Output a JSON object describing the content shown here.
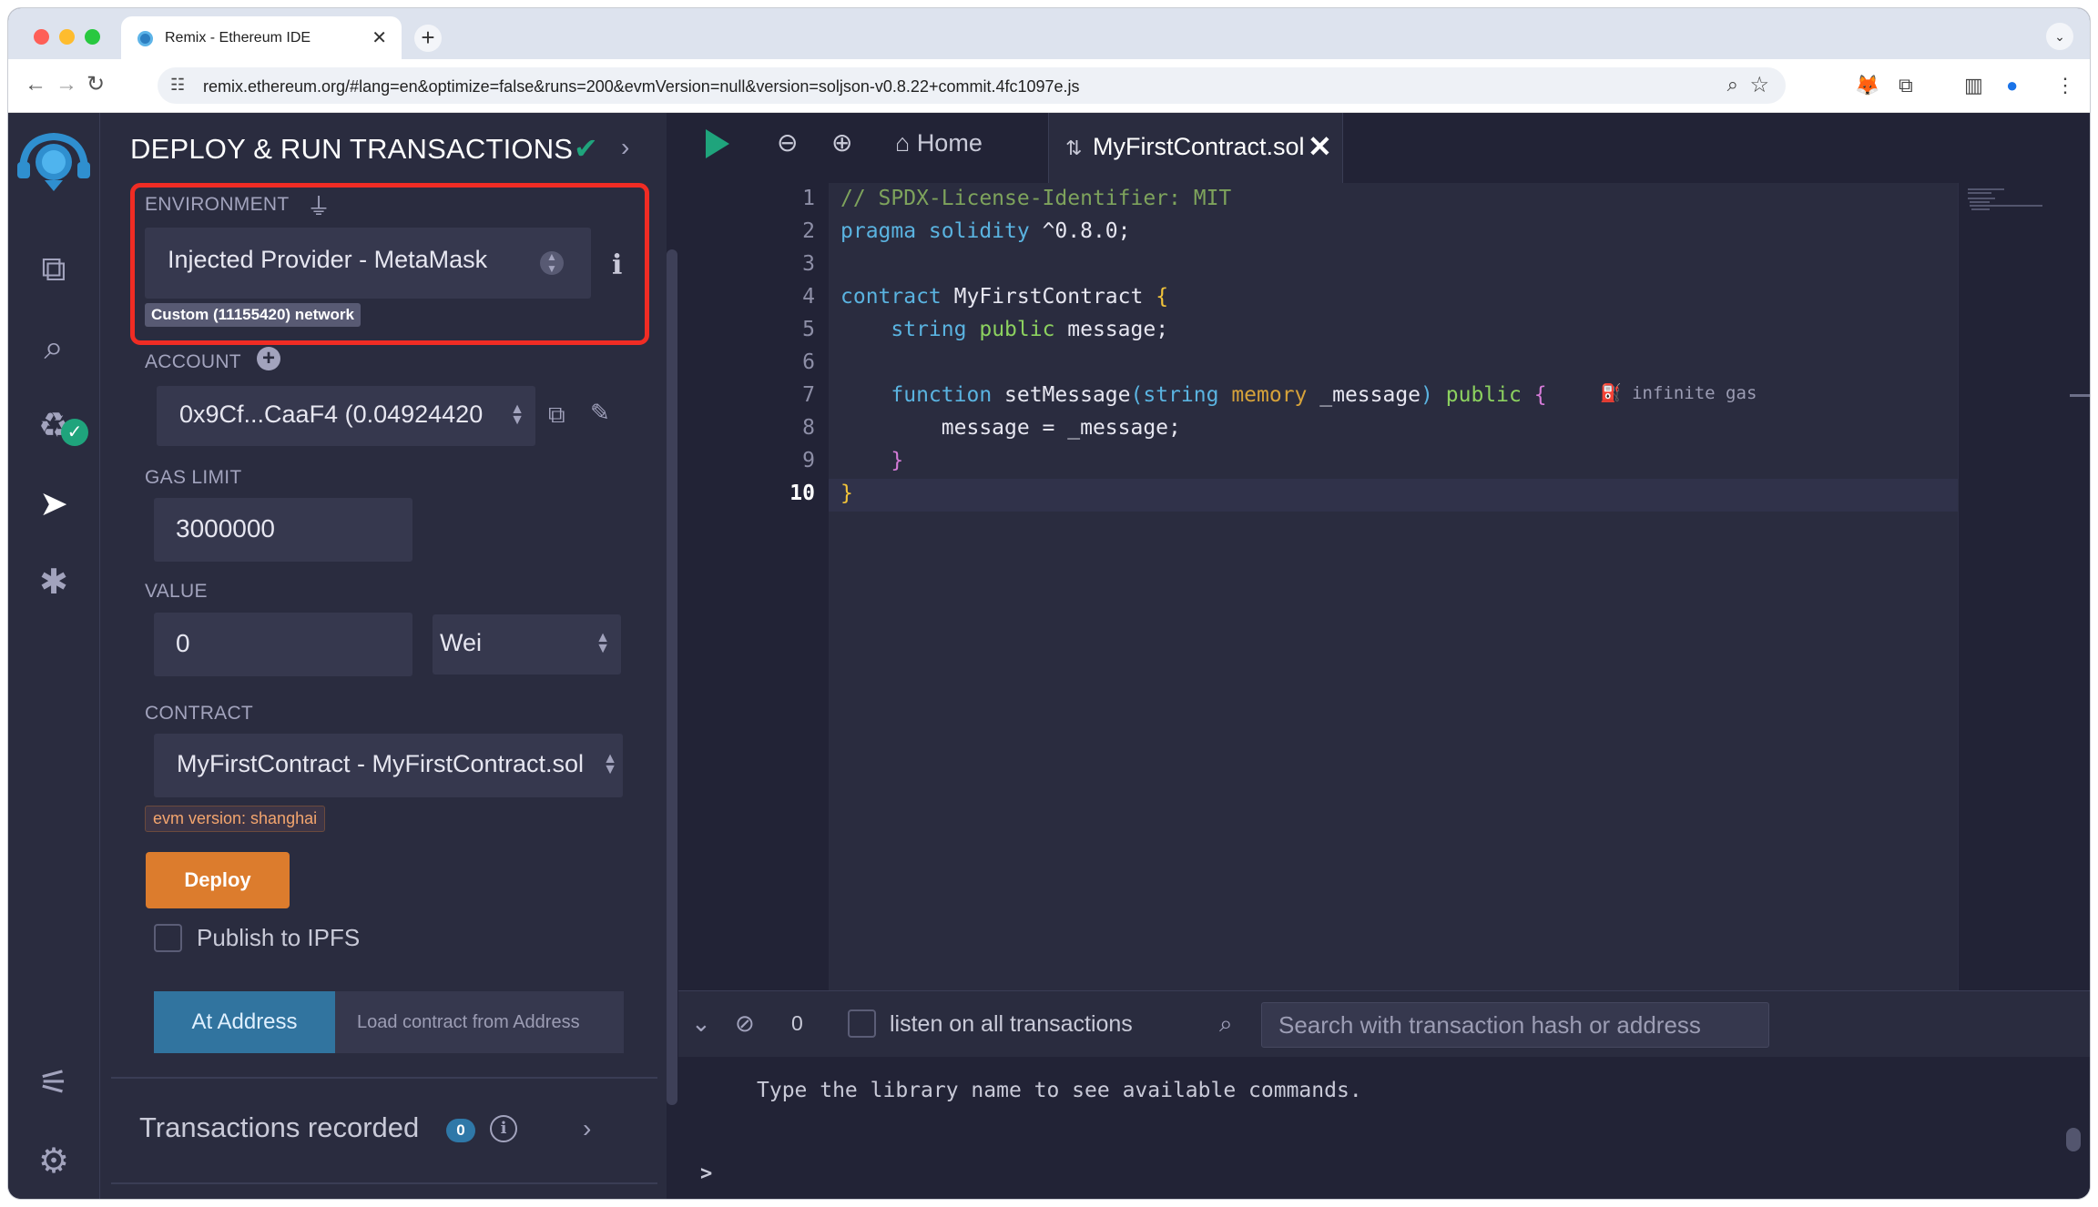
{
  "browser": {
    "tab_title": "Remix - Ethereum IDE",
    "tab_close": "✕",
    "new_tab": "+",
    "tab_menu": "⌄",
    "url": "remix.ethereum.org/#lang=en&optimize=false&runs=200&evmVersion=null&version=soljson-v0.8.22+commit.4fc1097e.js",
    "back": "←",
    "forward": "→",
    "reload": "↻"
  },
  "sidebar": {
    "items": [
      "file-explorer",
      "search",
      "solidity-compiler",
      "deploy-run",
      "debugger",
      "plugin-manager",
      "settings"
    ],
    "active": "deploy-run"
  },
  "panel": {
    "title": "DEPLOY & RUN TRANSACTIONS",
    "environment": {
      "label": "ENVIRONMENT",
      "value": "Injected Provider - MetaMask",
      "network_badge": "Custom (11155420) network"
    },
    "account": {
      "label": "ACCOUNT",
      "value": "0x9Cf...CaaF4 (0.04924420"
    },
    "gas_limit": {
      "label": "GAS LIMIT",
      "value": "3000000"
    },
    "value": {
      "label": "VALUE",
      "amount": "0",
      "unit": "Wei"
    },
    "contract": {
      "label": "CONTRACT",
      "value": "MyFirstContract - MyFirstContract.sol",
      "evm_badge": "evm version: shanghai"
    },
    "deploy_label": "Deploy",
    "publish_ipfs_label": "Publish to IPFS",
    "at_address_label": "At Address",
    "load_address_placeholder": "Load contract from Address",
    "transactions_recorded_label": "Transactions recorded",
    "transactions_recorded_count": "0"
  },
  "editor": {
    "home_tab_label": "Home",
    "file_tab_label": "MyFirstContract.sol",
    "line_numbers": [
      "1",
      "2",
      "3",
      "4",
      "5",
      "6",
      "7",
      "8",
      "9",
      "10"
    ],
    "gas_estimate": "infinite gas"
  },
  "terminal": {
    "count": "0",
    "listen_label": "listen on all transactions",
    "search_placeholder": "Search with transaction hash or address",
    "message": "Type the library name to see available commands.",
    "prompt": ">"
  },
  "colors": {
    "accent_green": "#1fa47c",
    "deploy_orange": "#dc7c2d",
    "at_address_blue": "#31749f",
    "highlight_red": "#f02c24"
  }
}
